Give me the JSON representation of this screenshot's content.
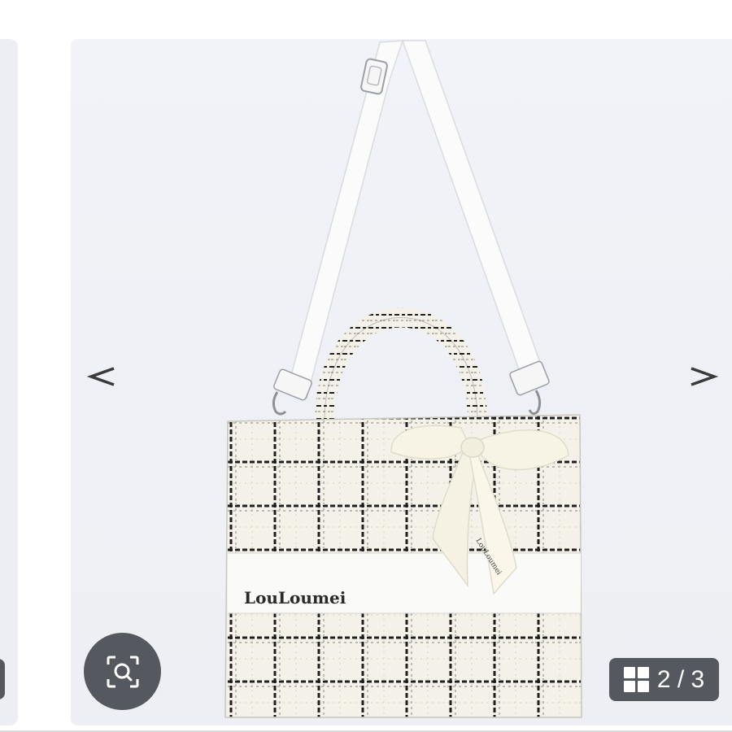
{
  "gallery": {
    "current": 2,
    "total": 3,
    "counter_text": "2 / 3",
    "prev_label": "<",
    "next_label": ">"
  },
  "product": {
    "brand_print": "LouLoumei",
    "ribbon_print": "LouLoumei"
  },
  "icons": {
    "prev": "chevron-left-icon",
    "next": "chevron-right-icon",
    "zoom": "image-search-icon",
    "grid": "grid-icon"
  },
  "colors": {
    "slide_background": "#eef0f5",
    "overlay_button": "#55585e",
    "bag_fabric": "#f4f1e8",
    "check_line": "#1e1e1e",
    "ribbon": "#f7f4e6"
  }
}
